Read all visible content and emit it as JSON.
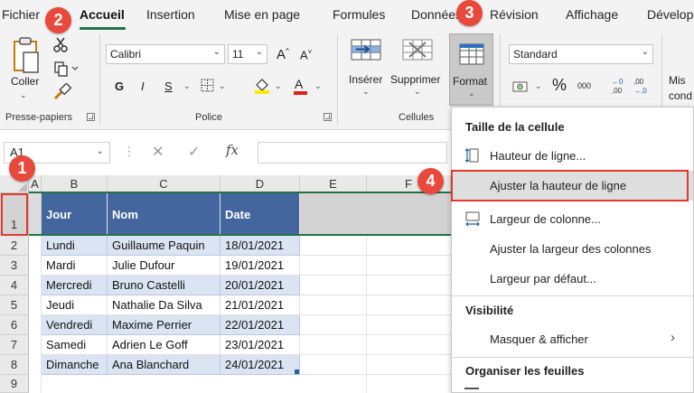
{
  "tabs": [
    {
      "label": "Fichier"
    },
    {
      "label": "Accueil"
    },
    {
      "label": "Insertion"
    },
    {
      "label": "Mise en page"
    },
    {
      "label": "Formules"
    },
    {
      "label": "Données"
    },
    {
      "label": "Révision"
    },
    {
      "label": "Affichage"
    },
    {
      "label": "Développeur"
    }
  ],
  "ribbon": {
    "coller": "Coller",
    "presse_papiers": "Presse-papiers",
    "font_name": "Calibri",
    "font_size": "11",
    "grow_font": "A^",
    "shrink_font": "A˅",
    "bold": "G",
    "italic": "I",
    "underline": "S",
    "police": "Police",
    "inserer": "Insérer",
    "supprimer": "Supprimer",
    "format": "Format",
    "cellules": "Cellules",
    "number_format": "Standard",
    "percent": "%",
    "thousands": "000",
    "inc_decimal": "←0\n,00",
    "dec_decimal": ",00\n→,0",
    "mise_en_forme": "Mis\ncond"
  },
  "formula_bar": {
    "name_box": "A1",
    "fx": "fx",
    "content": ""
  },
  "grid": {
    "columns": [
      "A",
      "B",
      "C",
      "D",
      "E",
      "F"
    ],
    "rows": [
      "1",
      "2",
      "3",
      "4",
      "5",
      "6",
      "7",
      "8",
      "9"
    ],
    "header": [
      "Jour",
      "Nom",
      "Date"
    ],
    "data": [
      [
        "Lundi",
        "Guillaume Paquin",
        "18/01/2021"
      ],
      [
        "Mardi",
        "Julie Dufour",
        "19/01/2021"
      ],
      [
        "Mercredi",
        "Bruno Castelli",
        "20/01/2021"
      ],
      [
        "Jeudi",
        "Nathalie Da Silva",
        "21/01/2021"
      ],
      [
        "Vendredi",
        "Maxime Perrier",
        "22/01/2021"
      ],
      [
        "Samedi",
        "Adrien Le Goff",
        "23/01/2021"
      ],
      [
        "Dimanche",
        "Ana Blanchard",
        "24/01/2021"
      ]
    ]
  },
  "menu": {
    "section_taille": "Taille de la cellule",
    "hauteur_ligne": "Hauteur de ligne...",
    "ajuster_hauteur": "Ajuster la hauteur de ligne",
    "largeur_colonne": "Largeur de colonne...",
    "ajuster_largeur": "Ajuster la largeur des colonnes",
    "largeur_defaut": "Largeur par défaut...",
    "section_visibilite": "Visibilité",
    "masquer_afficher": "Masquer & afficher",
    "section_organiser": "Organiser les feuilles"
  },
  "badges": [
    "1",
    "2",
    "3",
    "4"
  ],
  "colors": {
    "accent_green": "#217346",
    "header_blue": "#44669e",
    "row_blue": "#dbe4f2",
    "badge_red": "#e8493c",
    "highlight_red": "#e03a2f"
  }
}
